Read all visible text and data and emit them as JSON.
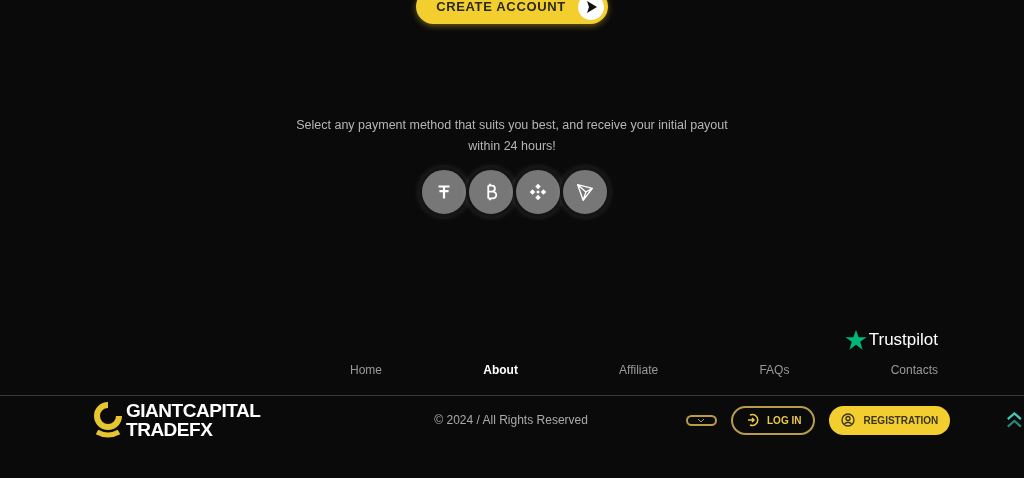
{
  "cta": {
    "label": "CREATE ACCOUNT"
  },
  "payment_text": "Select any payment method that suits you best, and receive your initial payout within 24 hours!",
  "payment_methods": [
    {
      "kind": "tether"
    },
    {
      "kind": "bitcoin"
    },
    {
      "kind": "binance"
    },
    {
      "kind": "tron"
    }
  ],
  "trustpilot": {
    "label": "Trustpilot"
  },
  "nav": [
    {
      "label": "Home",
      "selected": false
    },
    {
      "label": "About",
      "selected": true
    },
    {
      "label": "Affiliate",
      "selected": false
    },
    {
      "label": "FAQs",
      "selected": false
    },
    {
      "label": "Contacts",
      "selected": false
    }
  ],
  "logo": {
    "line1": "GIANTCAPITAL",
    "line2": "TRADEFX"
  },
  "copyright": "© 2024 / All Rights Reserved",
  "login": {
    "label": "LOG IN"
  },
  "registration": {
    "label": "REGISTRATION"
  }
}
